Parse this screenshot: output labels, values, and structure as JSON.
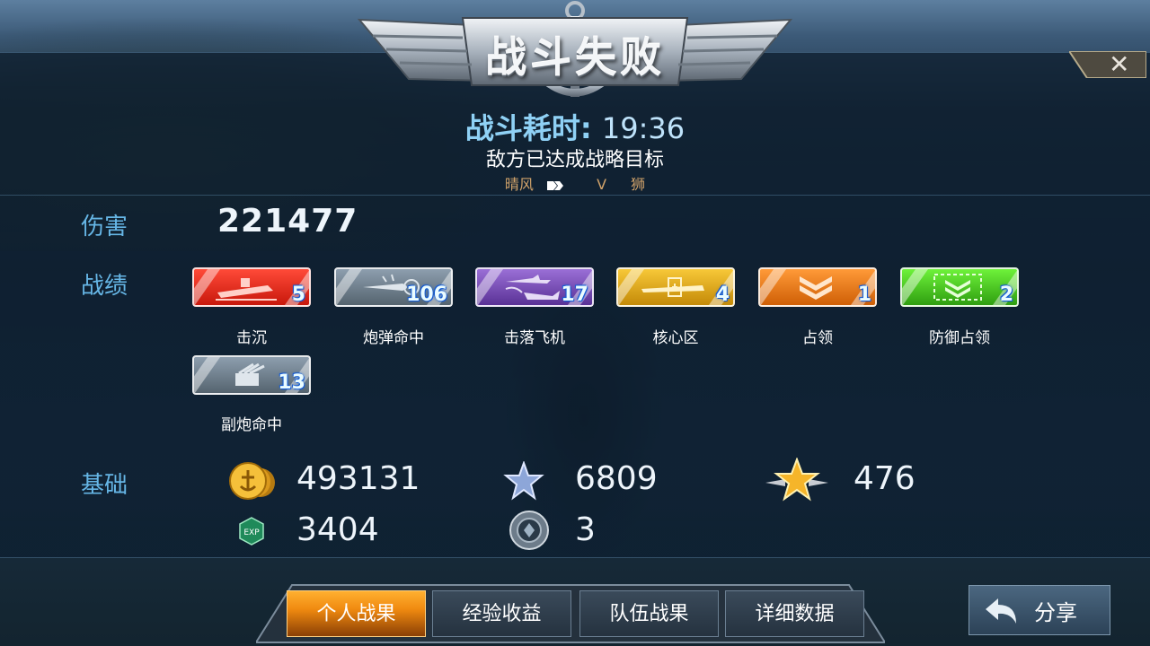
{
  "header": {
    "title": "战斗失败",
    "close_icon": "close-icon",
    "close_glyph": "✕"
  },
  "battle": {
    "duration_label": "战斗耗时:",
    "duration_value": "19:36",
    "result_text": "敌方已达成战略目标",
    "player_left": "晴风",
    "vs": "V",
    "player_right": "狮"
  },
  "damage": {
    "label": "伤害",
    "value": "221477"
  },
  "record": {
    "label": "战绩",
    "medals": [
      {
        "name": "击沉",
        "count": "5",
        "color": "#e0281c",
        "icon": "ship-sunk-icon"
      },
      {
        "name": "炮弹命中",
        "count": "106",
        "color": "#6a7c8c",
        "icon": "shell-hit-icon"
      },
      {
        "name": "击落飞机",
        "count": "17",
        "color": "#7a4fb8",
        "icon": "plane-shot-icon"
      },
      {
        "name": "核心区",
        "count": "4",
        "color": "#e0a616",
        "icon": "core-zone-icon"
      },
      {
        "name": "占领",
        "count": "1",
        "color": "#e67a16",
        "icon": "capture-icon"
      },
      {
        "name": "防御占领",
        "count": "2",
        "color": "#3fc81a",
        "icon": "defend-capture-icon"
      },
      {
        "name": "副炮命中",
        "count": "13",
        "color": "#6a7c8c",
        "icon": "secondary-gun-icon"
      }
    ]
  },
  "basic": {
    "label": "基础",
    "coins": "493131",
    "exp_star": "6809",
    "rank_star": "476",
    "exp": "3404",
    "tokens": "3"
  },
  "tabs": [
    "个人战果",
    "经验收益",
    "队伍战果",
    "详细数据"
  ],
  "share": {
    "label": "分享"
  }
}
